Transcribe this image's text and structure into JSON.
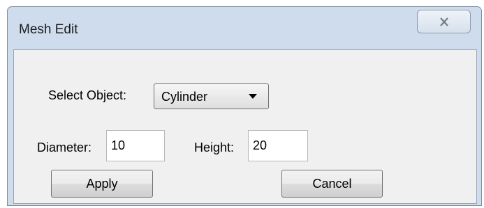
{
  "window": {
    "title": "Mesh Edit"
  },
  "form": {
    "select_object_label": "Select Object:",
    "select_object_value": "Cylinder",
    "diameter_label": "Diameter:",
    "diameter_value": "10",
    "height_label": "Height:",
    "height_value": "20"
  },
  "buttons": {
    "apply": "Apply",
    "cancel": "Cancel"
  },
  "icons": {
    "close": "close-icon",
    "dropdown": "chevron-down-icon"
  }
}
